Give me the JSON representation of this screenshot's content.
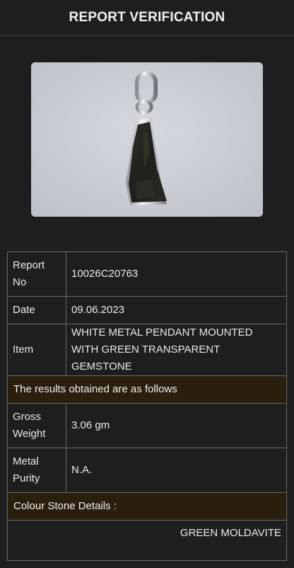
{
  "header": {
    "title": "REPORT VERIFICATION"
  },
  "report": {
    "report_no_label": "Report No",
    "report_no": "10026C20763",
    "date_label": "Date",
    "date": "09.06.2023",
    "item_label": "Item",
    "item": "WHITE METAL PENDANT MOUNTED WITH GREEN TRANSPARENT GEMSTONE",
    "results_heading": "The results obtained are as follows",
    "gross_weight_label": "Gross Weight",
    "gross_weight": "3.06 gm",
    "metal_purity_label": "Metal Purity",
    "metal_purity": "N.A.",
    "colour_stone_heading": "Colour Stone Details :",
    "colour_stone": "GREEN MOLDAVITE"
  },
  "colors": {
    "background": "#1e1e1e",
    "section_row": "#2a1e0d",
    "border": "#6b6b6b"
  }
}
